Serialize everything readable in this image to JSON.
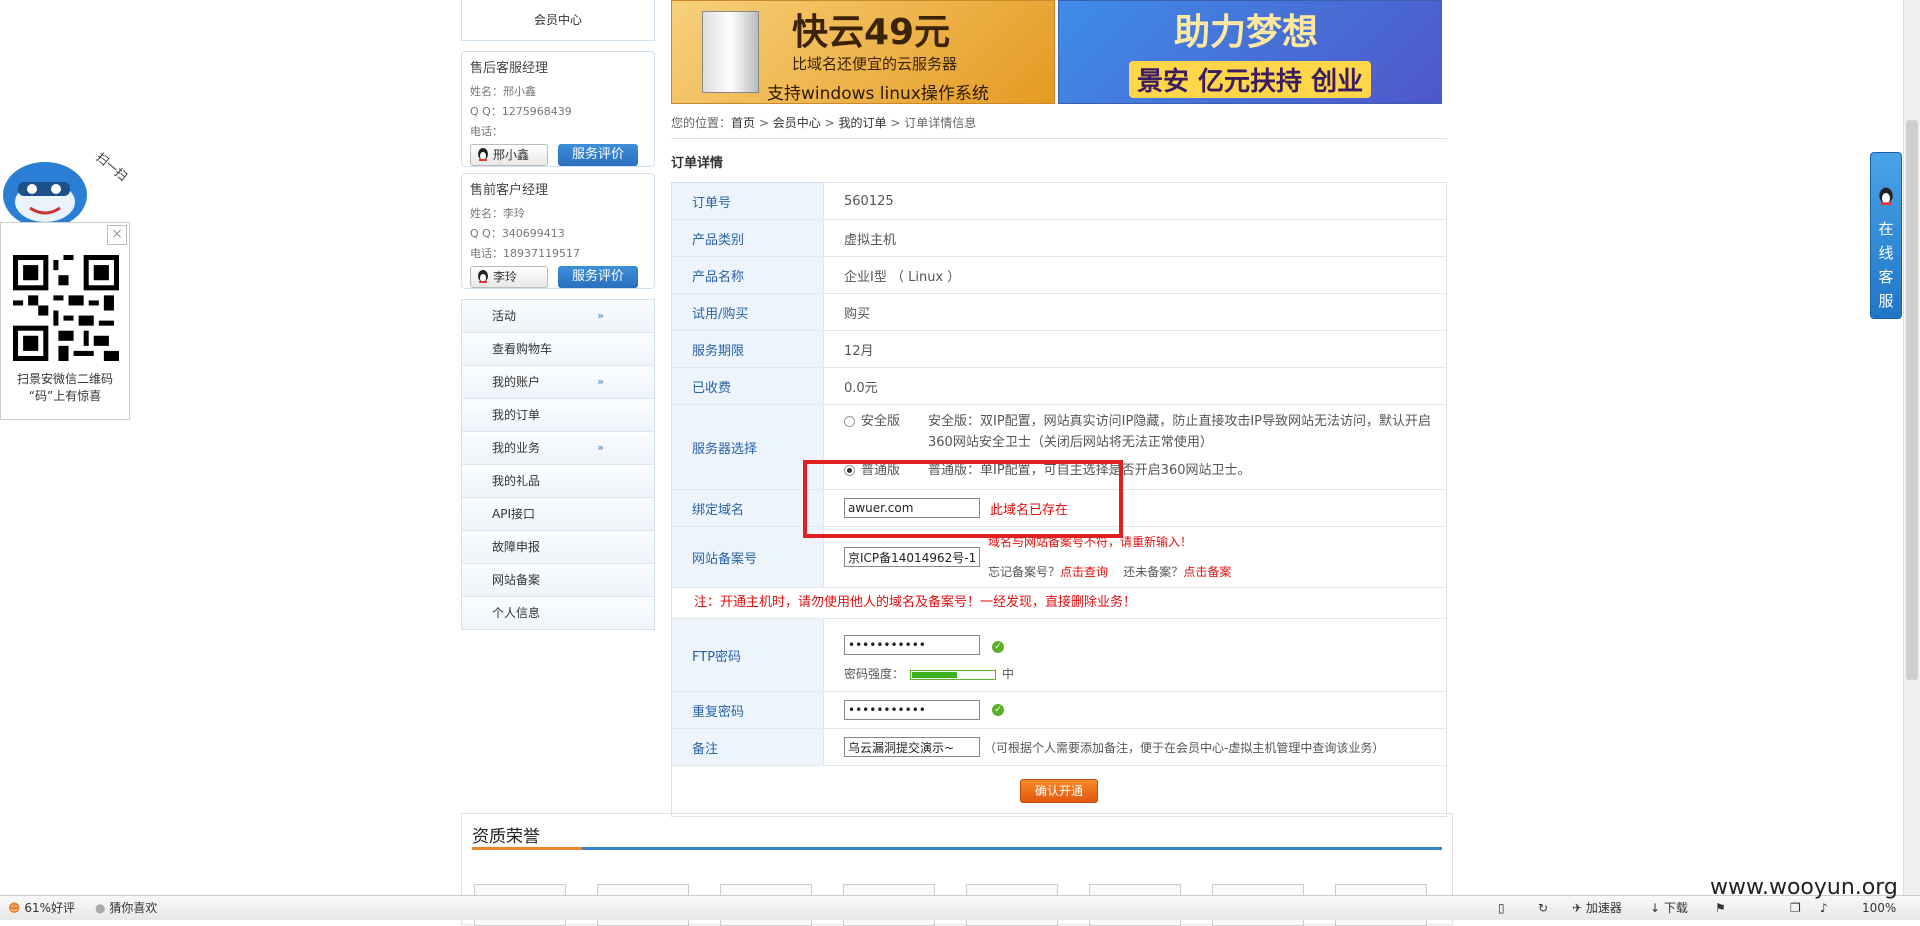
{
  "qr_widget": {
    "close": "×",
    "caption_line1": "扫景安微信二维码",
    "caption_line2": "“码”上有惊喜",
    "mascot_text": "扫一扫"
  },
  "sidebar": {
    "member_center": "会员中心",
    "after_sales": {
      "title": "售后客服经理",
      "name": "姓名：邢小鑫",
      "qq": "Q Q：1275968439",
      "phone": "电话：",
      "qq_button": "邢小鑫",
      "eval_button": "服务评价"
    },
    "pre_sales": {
      "title": "售前客户经理",
      "name": "姓名：李玲",
      "qq": "Q Q：340699413",
      "phone": "电话：18937119517",
      "qq_button": "李玲",
      "eval_button": "服务评价"
    },
    "menu": [
      {
        "label": "活动",
        "expand": "»"
      },
      {
        "label": "查看购物车"
      },
      {
        "label": "我的账户",
        "expand": "»"
      },
      {
        "label": "我的订单"
      },
      {
        "label": "我的业务",
        "expand": "»"
      },
      {
        "label": "我的礼品"
      },
      {
        "label": "API接口"
      },
      {
        "label": "故障申报"
      },
      {
        "label": "网站备案"
      },
      {
        "label": "个人信息"
      }
    ]
  },
  "banners": {
    "b1_big": "快云49元",
    "b1_mid": "比域名还便宜的云服务器",
    "b1_sub": "支持windows linux操作系统",
    "b2_big": "助力梦想",
    "b2_sub": "景安 亿元扶持 创业"
  },
  "breadcrumb": {
    "prefix": "您的位置：",
    "home": "首页",
    "member": "会员中心",
    "orders": "我的订单",
    "current": "订单详情信息",
    "sep": ">"
  },
  "section_title": "订单详情",
  "form": {
    "order_no_label": "订单号",
    "order_no": "560125",
    "category_label": "产品类别",
    "category": "虚拟主机",
    "product_label": "产品名称",
    "product": "企业I型 （ Linux ）",
    "trial_label": "试用/购买",
    "trial": "购买",
    "period_label": "服务期限",
    "period": "12月",
    "charged_label": "已收费",
    "charged": "0.0元",
    "server_label": "服务器选择",
    "opt_secure": "安全版",
    "opt_secure_desc": "安全版：双IP配置，网站真实访问IP隐藏，防止直接攻击IP导致网站无法访问，默认开启360网站安全卫士（关闭后网站将无法正常使用）",
    "opt_normal": "普通版",
    "opt_normal_desc": "普通版：单IP配置，可自主选择是否开启360网站卫士。",
    "domain_label": "绑定域名",
    "domain_value": "awuer.com",
    "domain_error": "此域名已存在",
    "icp_label": "网站备案号",
    "icp_value": "京ICP备14014962号-1",
    "icp_error": "域名与网站备案号不符，请重新输入！",
    "icp_forgot": "忘记备案号？",
    "icp_query": "点击查询",
    "icp_not": "还未备案？",
    "icp_apply": "点击备案",
    "warning": "注：开通主机时，请勿使用他人的域名及备案号！一经发现，直接删除业务！",
    "ftp_label": "FTP密码",
    "ftp_value": "•••••••••••",
    "strength_label": "密码强度：",
    "strength_text": "中",
    "strength_level": 0.55,
    "repeat_label": "重复密码",
    "repeat_value": "•••••••••••",
    "remark_label": "备注",
    "remark_value": "乌云漏洞提交演示~",
    "remark_hint": "（可根据个人需要添加备注，便于在会员中心-虚拟主机管理中查询该业务）",
    "submit": "确认开通"
  },
  "honors": {
    "title": "资质荣誉"
  },
  "kefu": {
    "text": "在\n线\n客\n服"
  },
  "statusbar": {
    "rating": "61%好评",
    "guess": "猜你喜欢",
    "accelerator": "加速器",
    "download": "下载",
    "zoom": "100%"
  },
  "watermark": "www.wooyun.org",
  "colors": {
    "accent_blue": "#2a63a8",
    "error_red": "#e01010",
    "submit_orange": "#e2580e",
    "highlight_red": "#e02020"
  }
}
